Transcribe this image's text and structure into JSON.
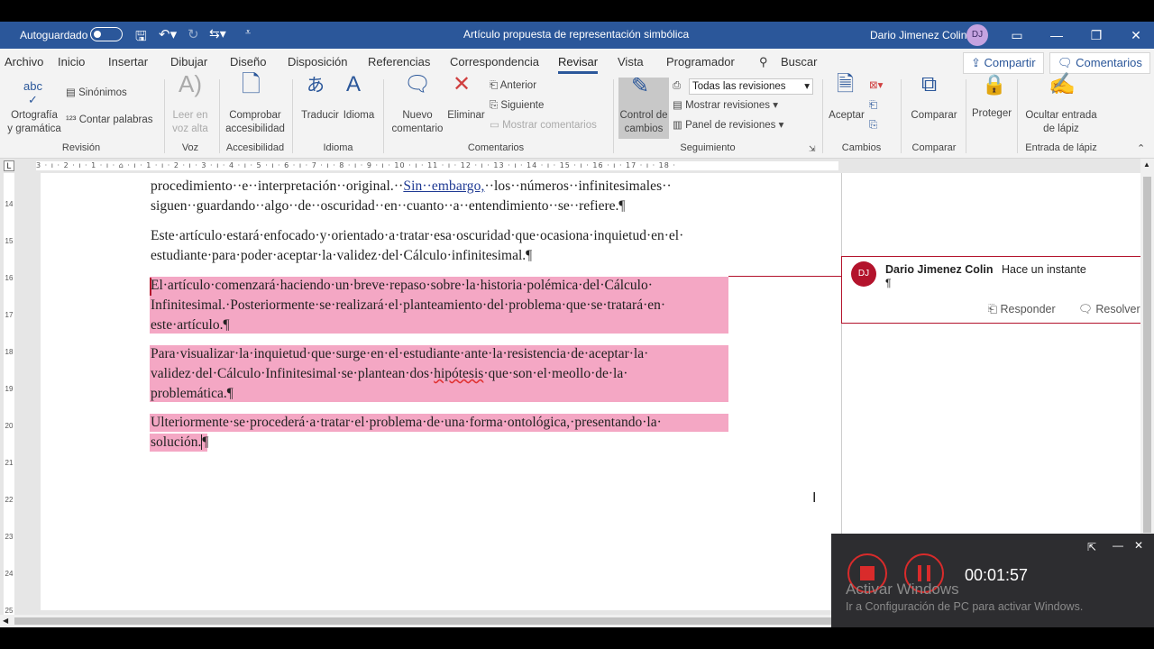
{
  "titlebar": {
    "autosave_label": "Autoguardado",
    "doc_title": "Artículo propuesta de representación simbólica",
    "user_name": "Dario Jimenez Colin",
    "user_initials": "DJ"
  },
  "tabs": [
    "Archivo",
    "Inicio",
    "Insertar",
    "Dibujar",
    "Diseño",
    "Disposición",
    "Referencias",
    "Correspondencia",
    "Revisar",
    "Vista",
    "Programador",
    "Buscar"
  ],
  "share_label": "Compartir",
  "comments_label": "Comentarios",
  "ribbon": {
    "spelling": "Ortografía\ny gramática",
    "synonyms": "Sinónimos",
    "word_count": "Contar palabras",
    "read_aloud": "Leer en\nvoz alta",
    "check_access": "Comprobar\naccesibilidad",
    "translate": "Traducir",
    "language": "Idioma",
    "new_comment": "Nuevo\ncomentario",
    "delete": "Eliminar",
    "previous": "Anterior",
    "next": "Siguiente",
    "show_comments": "Mostrar comentarios",
    "track_changes": "Control de\ncambios",
    "all_revisions": "Todas las revisiones",
    "show_revisions": "Mostrar revisiones",
    "revisions_pane": "Panel de revisiones",
    "accept": "Aceptar",
    "compare": "Comparar",
    "protect": "Proteger",
    "hide_ink": "Ocultar entrada\nde lápiz",
    "groups": {
      "revision": "Revisión",
      "voice": "Voz",
      "accessibility": "Accesibilidad",
      "language": "Idioma",
      "comments": "Comentarios",
      "tracking": "Seguimiento",
      "changes": "Cambios",
      "compare": "Comparar",
      "ink": "Entrada de lápiz"
    }
  },
  "ruler_text": "3 · ı · 2 · ı · 1 · ı · ⌂ · ı · 1 · ı · 2 · ı · 3 · ı · 4 · ı · 5 · ı · 6 · ı · 7 · ı · 8 · ı · 9 · ı · 10 · ı · 11 · ı · 12 · ı · 13 · ı · 14 · ı · 15 · ı · 16 · ı · 17 · ı · 18 ·",
  "vruler_numbers": [
    "14",
    "15",
    "16",
    "17",
    "18",
    "19",
    "20",
    "21",
    "22",
    "23",
    "24",
    "25"
  ],
  "doc": {
    "p1_l1a": "procedimiento··e··interpretación··original.··",
    "p1_l1_link": "Sin··embargo,",
    "p1_l1b": "··los··números··infinitesimales··",
    "p1_l2": "siguen··guardando··algo··de··oscuridad··en··cuanto··a··entendimiento··se··refiere.¶",
    "p2_l1": "Este·artículo·estará·enfocado·y·orientado·a·tratar·esa·oscuridad·que·ocasiona·inquietud·en·el·",
    "p2_l2": "estudiante·para·poder·aceptar·la·validez·del·Cálculo·infinitesimal.¶",
    "p3_l1": "El·artículo·comenzará·haciendo·un·breve·repaso·sobre·la·historia·polémica·del·Cálculo·",
    "p3_l2": "Infinitesimal.·Posteriormente·se·realizará·el·planteamiento·del·problema·que·se·tratará·en·",
    "p3_l3": "este·artículo.¶",
    "p4_l1": "Para·visualizar·la·inquietud·que·surge·en·el·estudiante·ante·la·resistencia·de·aceptar·la·",
    "p4_l2a": "validez·del·Cálculo·Infinitesimal·se·plantean·dos·",
    "p4_l2_err": "hipótesis",
    "p4_l2b": "·que·son·el·meollo·de·la·",
    "p4_l3": "problemática.¶",
    "p5_l1": "Ulteriormente·se·procederá·a·tratar·el·problema·de·una·forma·ontológica,·presentando·la·",
    "p5_l2": "solución.",
    "p5_l2_mark": "¶"
  },
  "comment": {
    "author": "Dario Jimenez Colin",
    "time": "Hace un instante",
    "initials": "DJ",
    "body": "¶",
    "reply": "Responder",
    "resolve": "Resolver"
  },
  "recorder": {
    "timer": "00:01:57"
  },
  "watermark": {
    "title": "Activar Windows",
    "subtitle": "Ir a Configuración de PC para activar Windows."
  },
  "colors": {
    "brand": "#2b579a",
    "highlight": "#f4a7c4",
    "comment_accent": "#b3132c"
  }
}
